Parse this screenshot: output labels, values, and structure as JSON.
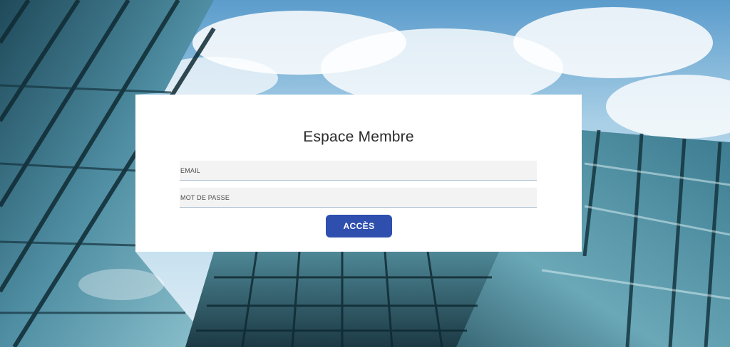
{
  "login": {
    "title": "Espace Membre",
    "email_placeholder": "EMAIL",
    "password_placeholder": "MOT DE PASSE",
    "submit_label": "ACCÈS"
  },
  "colors": {
    "button": "#2e4fae",
    "card": "#ffffff",
    "field_bg": "#f3f3f3",
    "field_border": "#a9bdd0"
  }
}
